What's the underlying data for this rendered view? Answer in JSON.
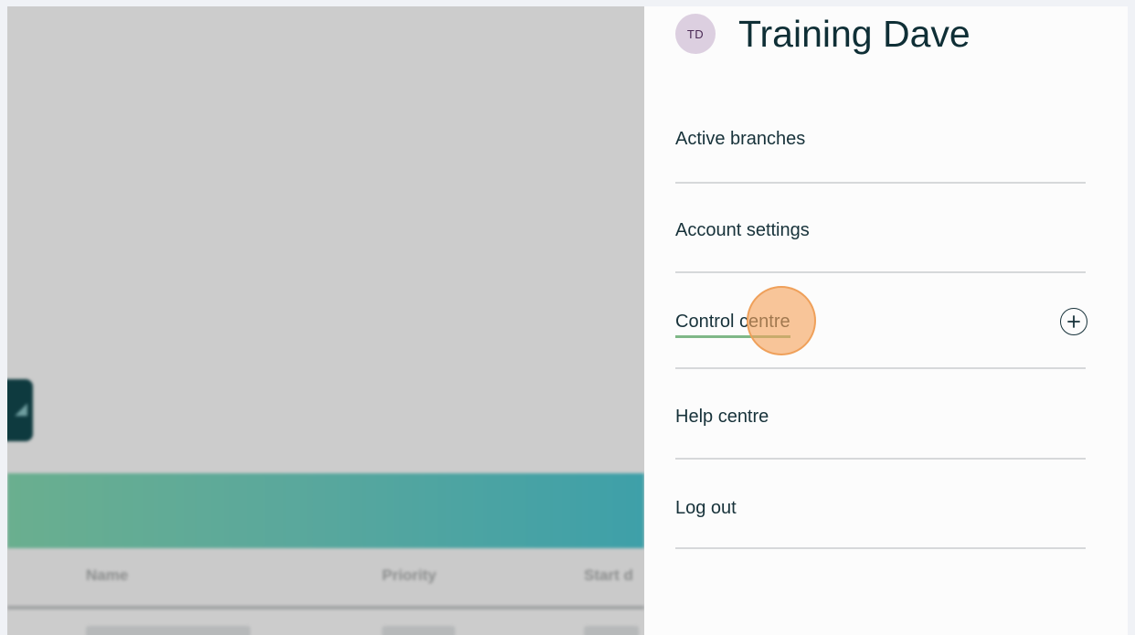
{
  "background_page": {
    "table_columns": [
      "Name",
      "Priority",
      "Start d"
    ]
  },
  "user": {
    "initials": "TD",
    "name": "Training Dave"
  },
  "menu": {
    "items": [
      {
        "label": "Active branches"
      },
      {
        "label": "Account settings"
      },
      {
        "label": "Control centre",
        "expandable": true,
        "active": true
      },
      {
        "label": "Help centre"
      },
      {
        "label": "Log out"
      }
    ]
  },
  "icons": {
    "expand": "plus-circle-icon"
  },
  "colors": {
    "accent_underline": "#7fb887",
    "banner_start": "#6aaf8f",
    "banner_end": "#3ea0a9",
    "text_dark": "#0f2f36",
    "avatar_bg": "#dccfe0",
    "click_marker": "#f6a35c"
  }
}
